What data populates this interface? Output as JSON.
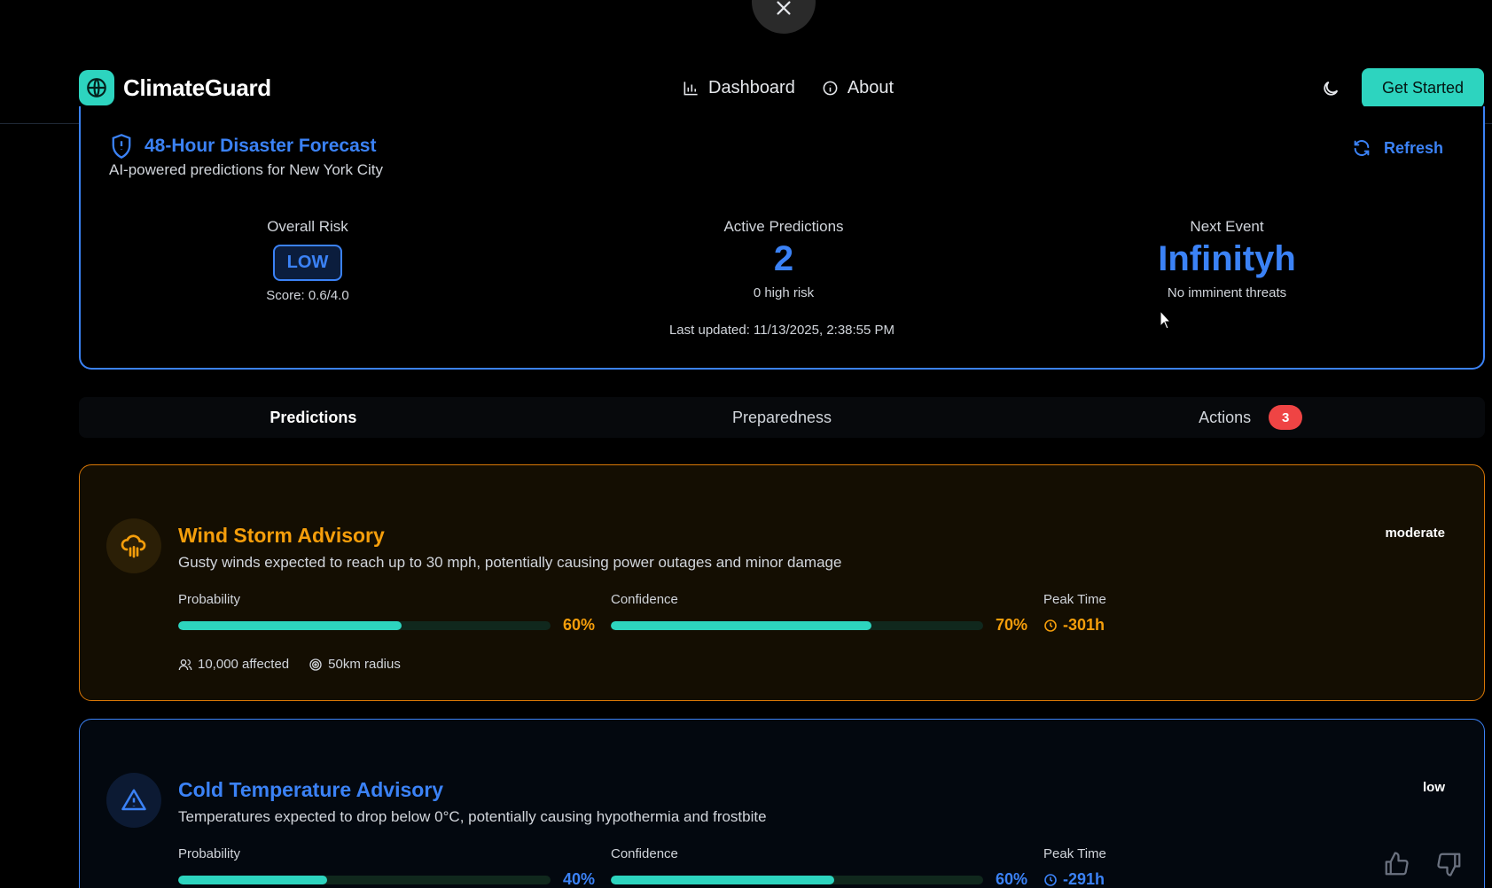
{
  "brand": {
    "name": "ClimateGuard"
  },
  "nav": {
    "links": [
      {
        "label": "Dashboard",
        "icon": "bar-chart-icon"
      },
      {
        "label": "About",
        "icon": "info-icon"
      }
    ],
    "cta_label": "Get Started"
  },
  "forecast": {
    "title": "48-Hour Disaster Forecast",
    "subtitle": "AI-powered predictions for New York City",
    "refresh_label": "Refresh",
    "overall_risk": {
      "label": "Overall Risk",
      "level": "LOW",
      "score": "Score: 0.6/4.0"
    },
    "active_predictions": {
      "label": "Active Predictions",
      "value": "2",
      "sub": "0 high risk"
    },
    "next_event": {
      "label": "Next Event",
      "value": "Infinityh",
      "sub": "No imminent threats"
    },
    "last_updated": "Last updated: 11/13/2025, 2:38:55 PM"
  },
  "tabs": [
    {
      "label": "Predictions",
      "active": true
    },
    {
      "label": "Preparedness",
      "active": false
    },
    {
      "label": "Actions",
      "active": false,
      "badge": "3"
    }
  ],
  "predictions": [
    {
      "title": "Wind Storm Advisory",
      "description": "Gusty winds expected to reach up to 30 mph, potentially causing power outages and minor damage",
      "severity": "moderate",
      "icon": "cloud-rain-icon",
      "probability_label": "Probability",
      "probability": 60,
      "probability_text": "60%",
      "confidence_label": "Confidence",
      "confidence": 70,
      "confidence_text": "70%",
      "peak_label": "Peak Time",
      "peak_time": "-301h",
      "affected": "10,000 affected",
      "radius": "50km radius"
    },
    {
      "title": "Cold Temperature Advisory",
      "description": "Temperatures expected to drop below 0°C, potentially causing hypothermia and frostbite",
      "severity": "low",
      "icon": "warning-triangle-icon",
      "probability_label": "Probability",
      "probability": 40,
      "probability_text": "40%",
      "confidence_label": "Confidence",
      "confidence": 60,
      "confidence_text": "60%",
      "peak_label": "Peak Time",
      "peak_time": "-291h"
    }
  ],
  "colors": {
    "accent": "#2dd4bf",
    "blue": "#3b82f6",
    "orange": "#f59e0b",
    "badge": "#ef4444"
  }
}
